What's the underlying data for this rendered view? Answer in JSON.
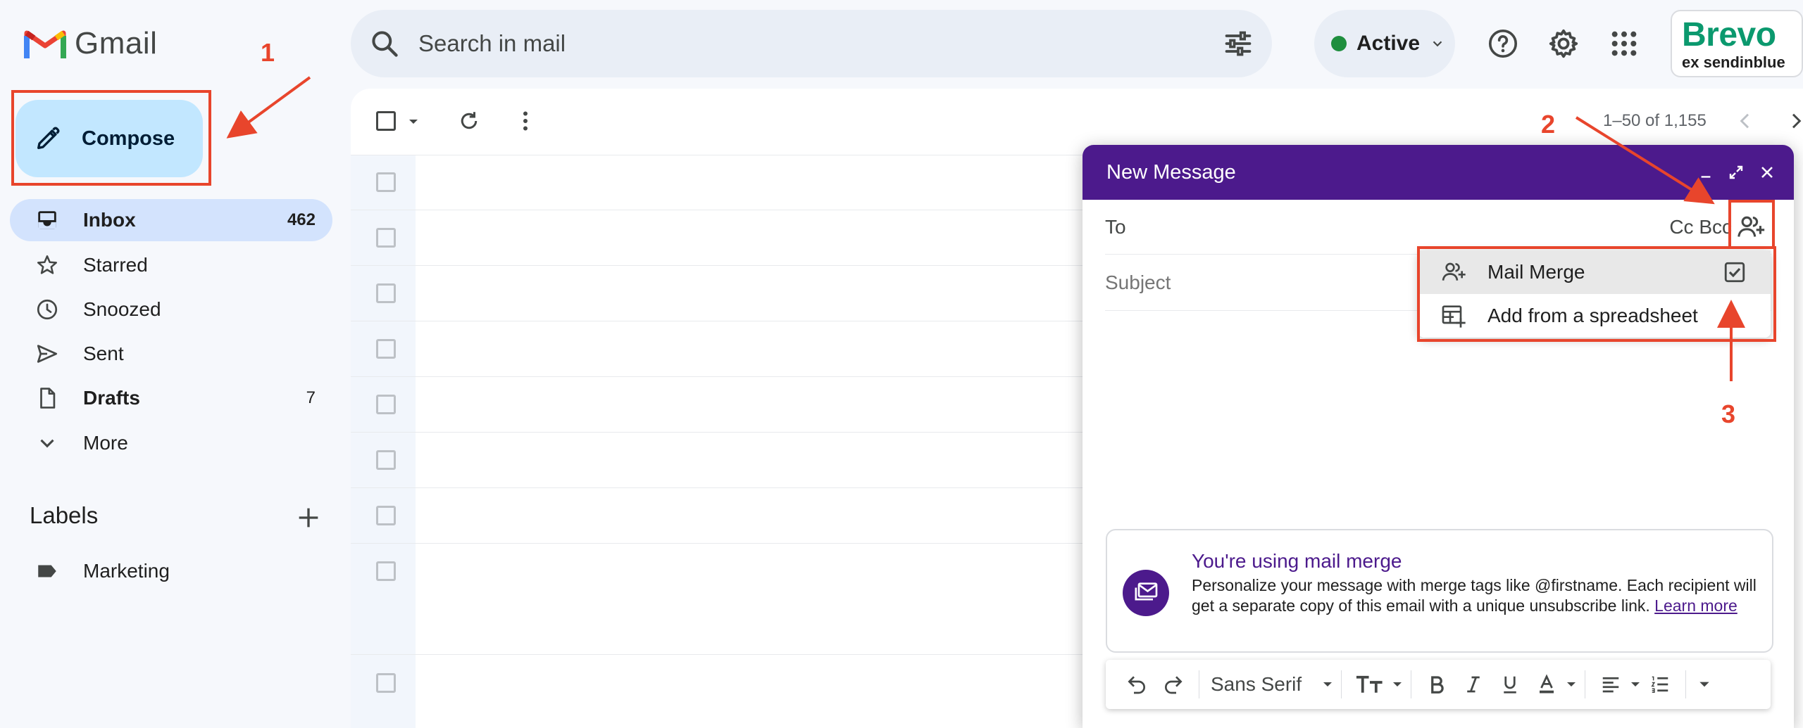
{
  "app": {
    "name": "Gmail"
  },
  "header": {
    "search_placeholder": "Search in mail",
    "status_label": "Active",
    "addon": {
      "name": "Brevo",
      "tagline": "ex sendinblue"
    }
  },
  "sidebar": {
    "compose_label": "Compose",
    "items": [
      {
        "label": "Inbox",
        "count": "462"
      },
      {
        "label": "Starred",
        "count": ""
      },
      {
        "label": "Snoozed",
        "count": ""
      },
      {
        "label": "Sent",
        "count": ""
      },
      {
        "label": "Drafts",
        "count": "7"
      },
      {
        "label": "More",
        "count": ""
      }
    ],
    "labels_title": "Labels",
    "labels": [
      {
        "name": "Marketing"
      }
    ]
  },
  "mail_list": {
    "pagination": "1–50 of 1,155"
  },
  "compose_window": {
    "title": "New Message",
    "to_label": "To",
    "cc_bcc": "Cc Bcc",
    "subject_placeholder": "Subject",
    "menu": [
      {
        "label": "Mail Merge",
        "checked": true
      },
      {
        "label": "Add from a spreadsheet"
      }
    ],
    "info": {
      "title": "You're using mail merge",
      "text": "Personalize your message with merge tags like @firstname. Each recipient will get a separate copy of this email with a unique unsubscribe link.",
      "link": "Learn more"
    },
    "toolbar": {
      "font": "Sans Serif"
    }
  },
  "annotations": {
    "step1": "1",
    "step2": "2",
    "step3": "3"
  },
  "colors": {
    "compose_bg": "#c2e7ff",
    "selected_nav": "#d3e3fd",
    "header_purple": "#4c1a8c",
    "annotation_red": "#e8452c",
    "active_green": "#1e8e3e",
    "brevo_green": "#0b996e"
  }
}
